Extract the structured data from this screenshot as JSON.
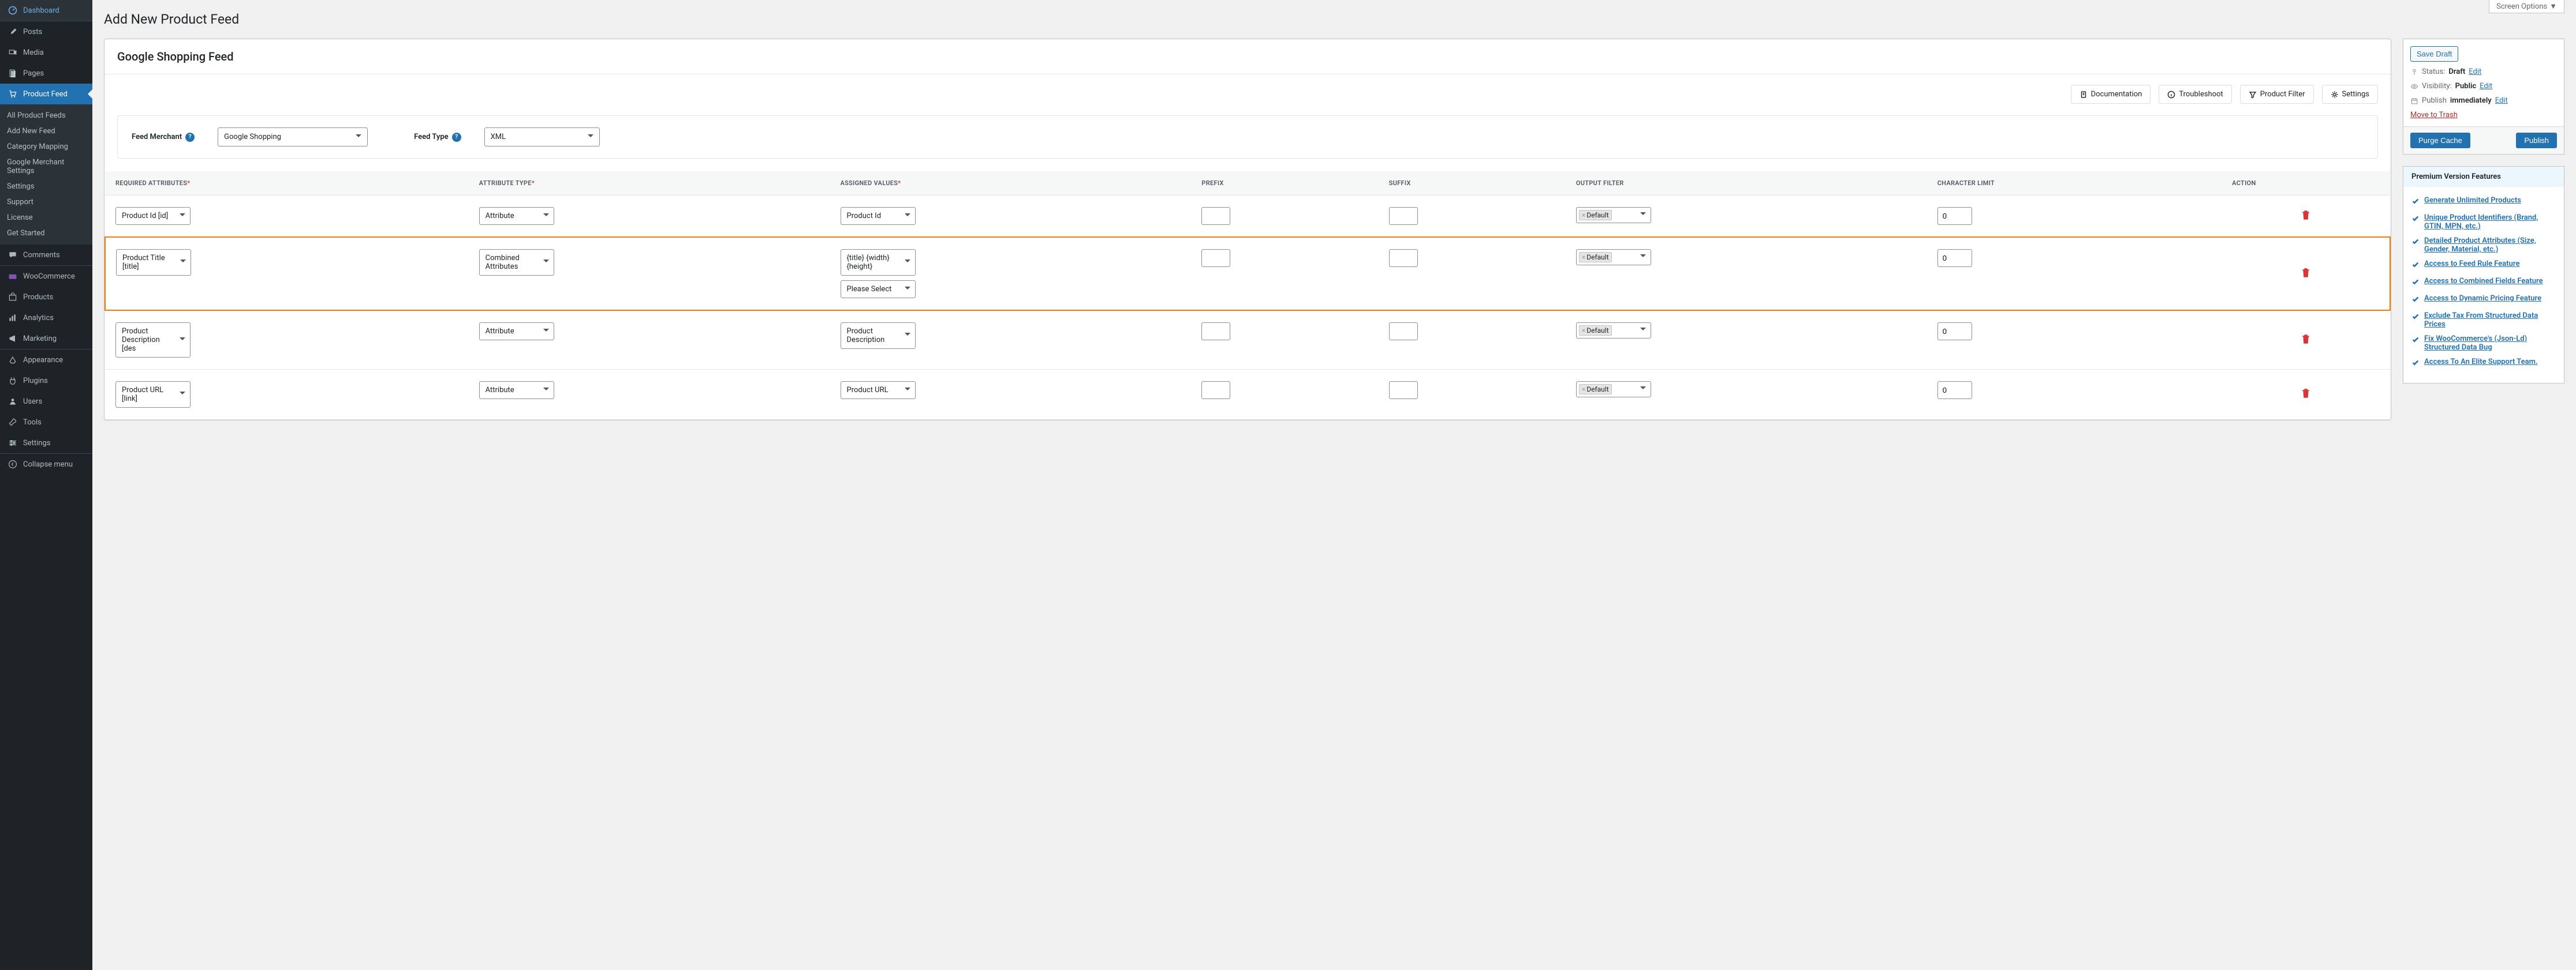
{
  "screen_options": "Screen Options",
  "sidebar": {
    "items": [
      {
        "label": "Dashboard"
      },
      {
        "label": "Posts"
      },
      {
        "label": "Media"
      },
      {
        "label": "Pages"
      },
      {
        "label": "Product Feed"
      },
      {
        "label": "Comments"
      },
      {
        "label": "WooCommerce"
      },
      {
        "label": "Products"
      },
      {
        "label": "Analytics"
      },
      {
        "label": "Marketing"
      },
      {
        "label": "Appearance"
      },
      {
        "label": "Plugins"
      },
      {
        "label": "Users"
      },
      {
        "label": "Tools"
      },
      {
        "label": "Settings"
      },
      {
        "label": "Collapse menu"
      }
    ],
    "submenu": [
      "All Product Feeds",
      "Add New Feed",
      "Category Mapping",
      "Google Merchant Settings",
      "Settings",
      "Support",
      "License",
      "Get Started"
    ]
  },
  "page_title": "Add New Product Feed",
  "feed_title": "Google Shopping Feed",
  "toolbar": {
    "documentation": "Documentation",
    "troubleshoot": "Troubleshoot",
    "product_filter": "Product Filter",
    "settings": "Settings"
  },
  "config": {
    "merchant_label": "Feed Merchant",
    "merchant_value": "Google Shopping",
    "type_label": "Feed Type",
    "type_value": "XML"
  },
  "columns": {
    "required": "Required Attributes",
    "attr_type": "Attribute Type",
    "assigned": "Assigned Values",
    "prefix": "Prefix",
    "suffix": "Suffix",
    "output": "Output Filter",
    "char": "Character Limit",
    "action": "Action"
  },
  "rows": [
    {
      "req": "Product Id [id]",
      "type": "Attribute",
      "assigned": "Product Id",
      "prefix": "",
      "suffix": "",
      "filter": "Default",
      "char": "0"
    },
    {
      "req": "Product Title [title]",
      "type": "Combined Attributes",
      "assigned": "{title} {width} {height}",
      "assigned2": "Please Select",
      "prefix": "",
      "suffix": "",
      "filter": "Default",
      "char": "0",
      "highlight": true
    },
    {
      "req": "Product Description [description]",
      "type": "Attribute",
      "assigned": "Product Description",
      "prefix": "",
      "suffix": "",
      "filter": "Default",
      "char": "0"
    },
    {
      "req": "Product URL [link]",
      "type": "Attribute",
      "assigned": "Product URL",
      "prefix": "",
      "suffix": "",
      "filter": "Default",
      "char": "0"
    }
  ],
  "publish": {
    "save_draft": "Save Draft",
    "status_label": "Status:",
    "status_value": "Draft",
    "visibility_label": "Visibility:",
    "visibility_value": "Public",
    "publish_label": "Publish",
    "publish_value": "immediately",
    "edit": "Edit",
    "trash": "Move to Trash",
    "purge": "Purge Cache",
    "publish_btn": "Publish"
  },
  "premium": {
    "title": "Premium Version Features",
    "items": [
      "Generate Unlimited Products",
      "Unique Product Identifiers (Brand, GTIN, MPN, etc.)",
      "Detailed Product Attributes (Size, Gender, Material, etc.)",
      "Access to Feed Rule Feature",
      "Access to Combined Fields Feature",
      "Access to Dynamic Pricing Feature",
      "Exclude Tax From Structured Data Prices",
      "Fix WooCommerce's (Json-Ld) Structured Data Bug",
      "Access To An Elite Support Team."
    ]
  }
}
